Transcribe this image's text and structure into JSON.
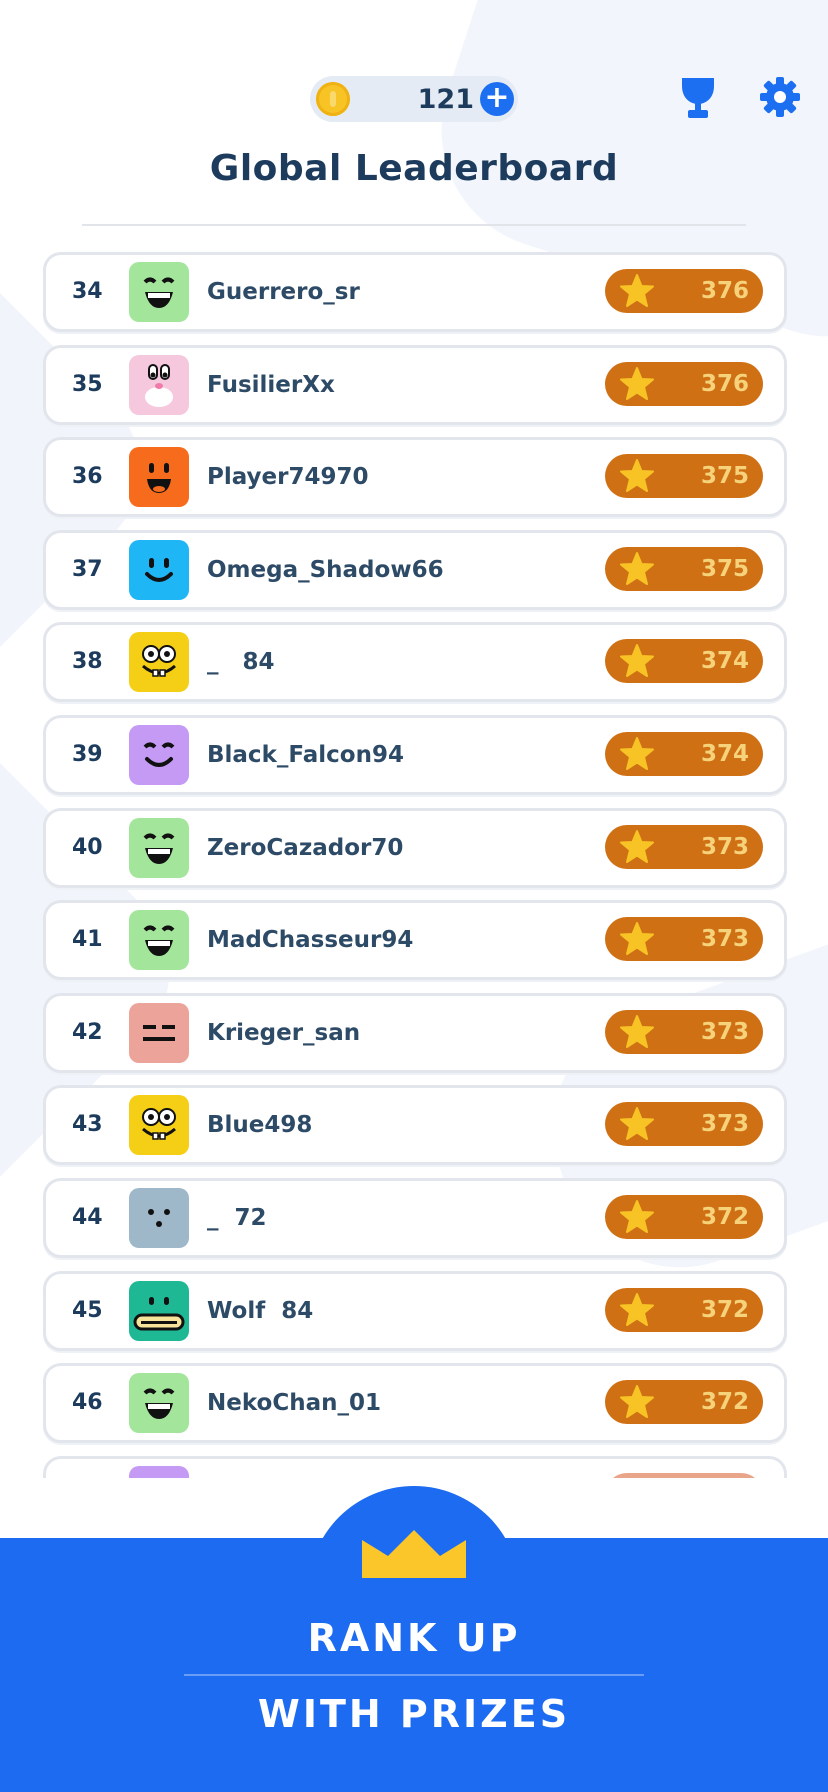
{
  "header": {
    "coins": "121",
    "title": "Global Leaderboard"
  },
  "colors": {
    "accent_blue": "#1d6ff2",
    "score_pill": "#cf7014",
    "score_text": "#f6d27a",
    "title_text": "#1d3b5c"
  },
  "leaderboard": {
    "rows": [
      {
        "rank": "34",
        "name": "Guerrero_sr",
        "score": "376",
        "avatar": "grin",
        "avatar_color": "#a4e59c"
      },
      {
        "rank": "35",
        "name": "FusilierXx",
        "score": "376",
        "avatar": "bunny",
        "avatar_color": "#f5c8de"
      },
      {
        "rank": "36",
        "name": "Player74970",
        "score": "375",
        "avatar": "smile-tongue",
        "avatar_color": "#f76b1c"
      },
      {
        "rank": "37",
        "name": "Omega_Shadow66",
        "score": "375",
        "avatar": "smile",
        "avatar_color": "#1fb6f5"
      },
      {
        "rank": "38",
        "name": "_   84",
        "score": "374",
        "avatar": "sponge",
        "avatar_color": "#f5cf16"
      },
      {
        "rank": "39",
        "name": "Black_Falcon94",
        "score": "374",
        "avatar": "happy",
        "avatar_color": "#c49af5"
      },
      {
        "rank": "40",
        "name": "ZeroCazador70",
        "score": "373",
        "avatar": "grin",
        "avatar_color": "#a4e59c"
      },
      {
        "rank": "41",
        "name": "MadChasseur94",
        "score": "373",
        "avatar": "grin",
        "avatar_color": "#a4e59c"
      },
      {
        "rank": "42",
        "name": "Krieger_san",
        "score": "373",
        "avatar": "flat",
        "avatar_color": "#eba39a"
      },
      {
        "rank": "43",
        "name": "Blue498",
        "score": "373",
        "avatar": "sponge",
        "avatar_color": "#f5cf16"
      },
      {
        "rank": "44",
        "name": "_  72",
        "score": "372",
        "avatar": "dots",
        "avatar_color": "#9fb8c9"
      },
      {
        "rank": "45",
        "name": "Wolf  84",
        "score": "372",
        "avatar": "mouth",
        "avatar_color": "#1fb894"
      },
      {
        "rank": "46",
        "name": "NekoChan_01",
        "score": "372",
        "avatar": "grin",
        "avatar_color": "#a4e59c"
      }
    ],
    "partial_row_avatar_color": "#c49af5"
  },
  "banner": {
    "line1": "RANK UP",
    "line2": "WITH PRIZES"
  },
  "icons": [
    "coin-icon",
    "plus-icon",
    "trophy-icon",
    "gear-icon",
    "star-icon",
    "crown-icon"
  ]
}
